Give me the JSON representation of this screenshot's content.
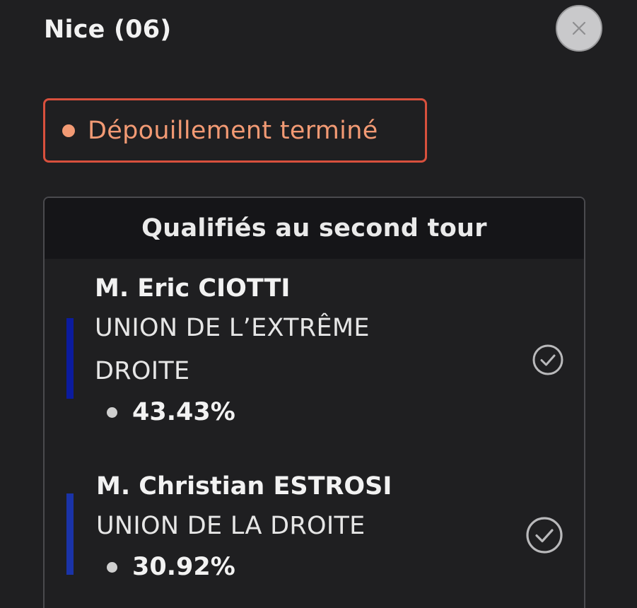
{
  "header": {
    "title": "Nice (06)",
    "close_icon": "close-icon"
  },
  "status": {
    "label": "Dépouillement terminé",
    "color": "#f29a74",
    "border_color": "#d8503d"
  },
  "qualified": {
    "heading": "Qualifiés au second tour",
    "candidates": [
      {
        "name": "M. Eric CIOTTI",
        "party": "UNION DE L’EXTRÊME DROITE",
        "score": "43.43%",
        "party_color": "#0b1b9e",
        "icon": "check-circle-icon"
      },
      {
        "name": "M. Christian ESTROSI",
        "party": "UNION DE LA DROITE",
        "score": "30.92%",
        "party_color": "#1a33a8",
        "icon": "check-circle-icon"
      }
    ]
  }
}
